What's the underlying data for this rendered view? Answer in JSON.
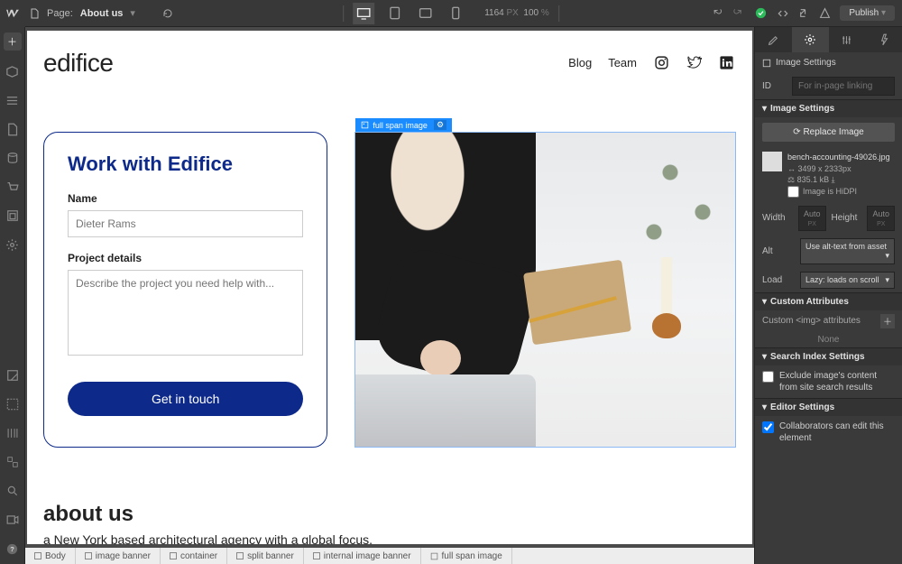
{
  "topbar": {
    "page_label": "Page:",
    "page_name": "About us",
    "width_px": "1164",
    "px_label": "PX",
    "zoom": "100",
    "zoom_unit": "%",
    "publish": "Publish"
  },
  "canvas": {
    "brand": "edifice",
    "nav": {
      "blog": "Blog",
      "team": "Team"
    },
    "card": {
      "title": "Work with Edifice",
      "name_label": "Name",
      "name_placeholder": "Dieter Rams",
      "details_label": "Project details",
      "details_placeholder": "Describe the project you need help with...",
      "cta": "Get in touch"
    },
    "selection_tag": "full span image",
    "about": {
      "heading": "about us",
      "body": "a New York based architectural agency with a global focus."
    }
  },
  "settings": {
    "panel_title": "Image Settings",
    "id_label": "ID",
    "id_placeholder": "For in-page linking",
    "section_image_settings": "Image Settings",
    "replace_btn": "Replace Image",
    "asset": {
      "filename": "bench-accounting-49026.jpg",
      "dimensions": "3499 x 2333px",
      "filesize": "835.1 kB",
      "hidpi": "Image is HiDPI"
    },
    "width_label": "Width",
    "height_label": "Height",
    "auto": "Auto",
    "px": "PX",
    "alt_label": "Alt",
    "alt_value": "Use alt-text from asset",
    "load_label": "Load",
    "load_value": "Lazy: loads on scroll",
    "section_custom": "Custom Attributes",
    "custom_desc": "Custom <img> attributes",
    "none": "None",
    "section_search": "Search Index Settings",
    "search_exclude": "Exclude image's content from site search results",
    "section_editor": "Editor Settings",
    "editor_collab": "Collaborators can edit this element"
  },
  "breadcrumb": [
    "Body",
    "image banner",
    "container",
    "split banner",
    "internal image banner",
    "full span image"
  ]
}
